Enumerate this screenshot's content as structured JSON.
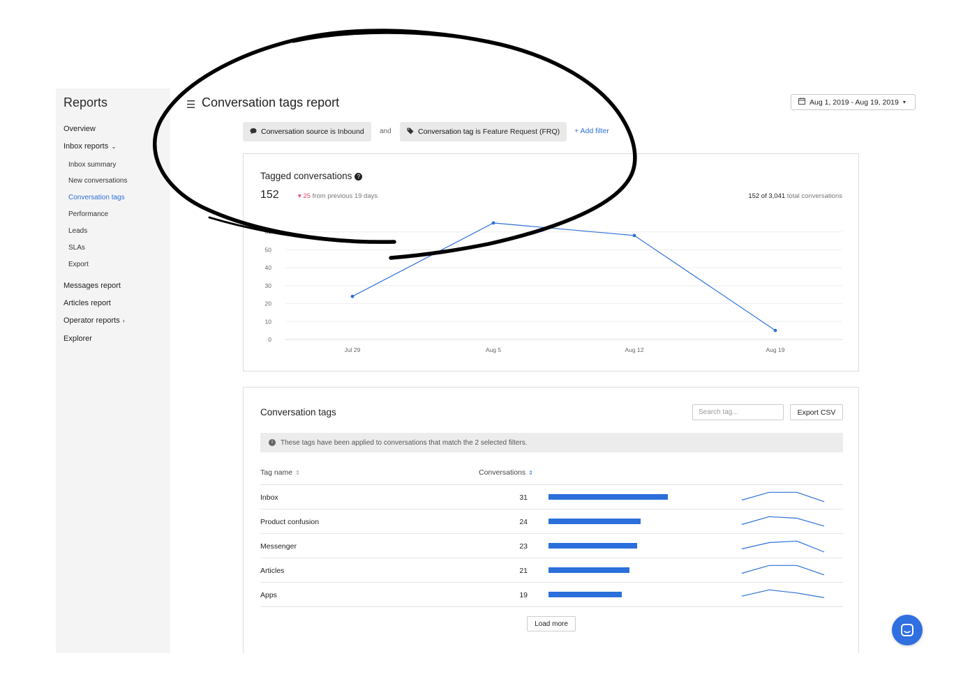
{
  "sidebar": {
    "title": "Reports",
    "items": [
      {
        "label": "Overview"
      },
      {
        "label": "Inbox reports"
      },
      {
        "label": "Inbox summary"
      },
      {
        "label": "New conversations"
      },
      {
        "label": "Conversation tags"
      },
      {
        "label": "Performance"
      },
      {
        "label": "Leads"
      },
      {
        "label": "SLAs"
      },
      {
        "label": "Export"
      },
      {
        "label": "Messages report"
      },
      {
        "label": "Articles report"
      },
      {
        "label": "Operator reports"
      },
      {
        "label": "Explorer"
      }
    ]
  },
  "header": {
    "title": "Conversation tags report",
    "date_range": "Aug 1, 2019 - Aug 19, 2019"
  },
  "filters": {
    "chip1": {
      "field": "Conversation source",
      "op": "is",
      "value": "Inbound"
    },
    "joiner": "and",
    "chip2": {
      "field": "Conversation tag",
      "op": "is",
      "value": "Feature Request (FRQ)"
    },
    "add_filter": "+ Add filter"
  },
  "summary": {
    "title": "Tagged conversations",
    "value": "152",
    "delta_value": "25",
    "delta_text": "from previous 19 days",
    "total_part": "152 of 3,041",
    "total_suffix": "total conversations"
  },
  "chart_data": {
    "type": "line",
    "x": [
      "Jul 29",
      "Aug 5",
      "Aug 12",
      "Aug 19"
    ],
    "values": [
      24,
      65,
      58,
      5
    ],
    "yticks": [
      0,
      10,
      20,
      30,
      40,
      50,
      60
    ],
    "ylim": [
      0,
      70
    ],
    "grid": true,
    "color": "#2e6fd9"
  },
  "tags_card": {
    "title": "Conversation tags",
    "search_placeholder": "Search tag...",
    "export_label": "Export CSV",
    "notice": "These tags have been applied to conversations that match the 2 selected filters.",
    "col_tag": "Tag name",
    "col_conversations": "Conversations",
    "load_more": "Load more",
    "rows": [
      {
        "name": "Inbox",
        "count": 31,
        "trend": [
          2,
          7,
          7,
          1
        ]
      },
      {
        "name": "Product confusion",
        "count": 24,
        "trend": [
          2,
          7,
          6,
          1
        ]
      },
      {
        "name": "Messenger",
        "count": 23,
        "trend": [
          2,
          6,
          7,
          0
        ]
      },
      {
        "name": "Articles",
        "count": 21,
        "trend": [
          2,
          7,
          7,
          1
        ]
      },
      {
        "name": "Apps",
        "count": 19,
        "trend": [
          3,
          7,
          5,
          2
        ]
      }
    ]
  },
  "colors": {
    "accent": "#2e6fd9",
    "bar": "#2a6fdb",
    "negative": "#e0466a"
  },
  "icons": {
    "menu": "hamburger-icon",
    "date": "calendar-icon",
    "source": "chat-bubble-icon",
    "tag": "tag-icon",
    "help": "question-circle-icon",
    "info": "info-circle-icon",
    "launcher": "messenger-launcher-icon"
  }
}
